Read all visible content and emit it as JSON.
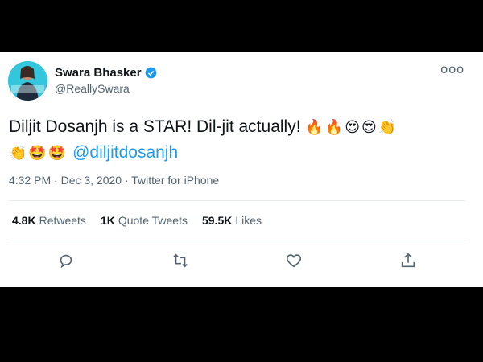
{
  "author": {
    "name": "Swara Bhasker",
    "handle": "@ReallySwara"
  },
  "tweet": {
    "text": "Diljit Dosanjh is a STAR! Dil-jit actually!",
    "emoji_line1": "🔥🔥😍😍👏",
    "emoji_line2": "👏🤩🤩",
    "mention": "@diljitdosanjh",
    "timestamp": "4:32 PM · Dec 3, 2020 · Twitter for iPhone"
  },
  "stats": {
    "retweets_count": "4.8K",
    "retweets_label": "Retweets",
    "quotes_count": "1K",
    "quotes_label": "Quote Tweets",
    "likes_count": "59.5K",
    "likes_label": "Likes"
  },
  "more_label": "ooo",
  "colors": {
    "accent": "#1d9bf0",
    "text": "#0f1419",
    "secondary": "#536471"
  },
  "icons": [
    "reply-icon",
    "retweet-icon",
    "like-icon",
    "share-icon",
    "verified-icon",
    "more-icon"
  ]
}
